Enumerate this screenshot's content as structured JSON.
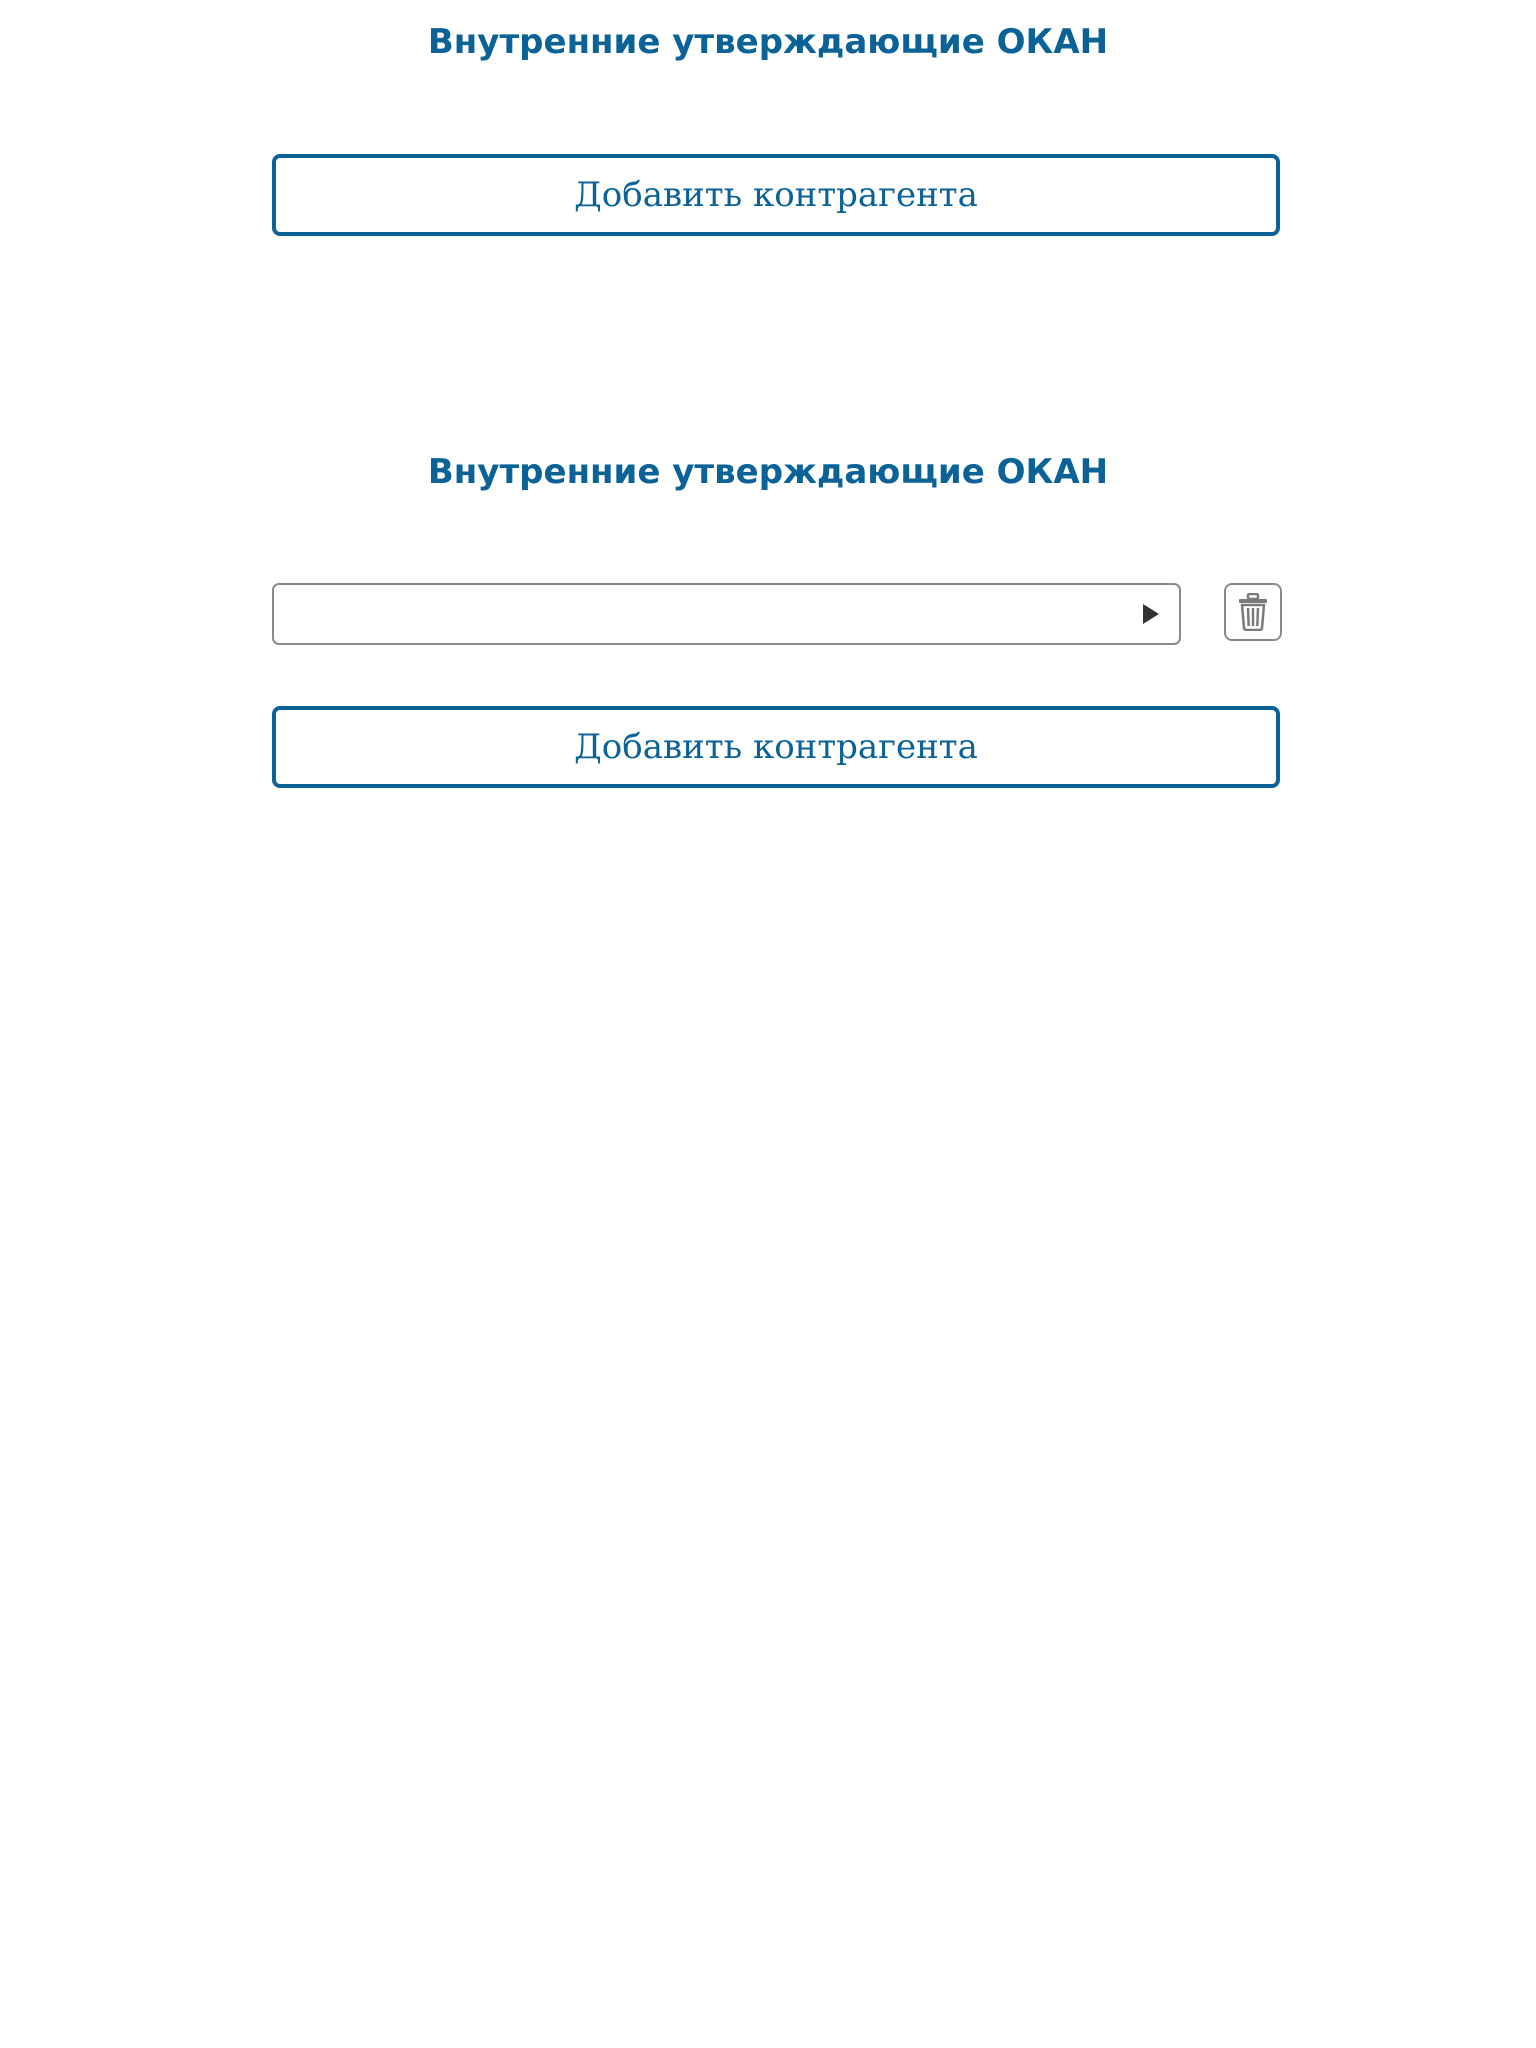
{
  "sections": [
    {
      "title": "Внутренние утверждающие ОКАН",
      "add_button_label": "Добавить контрагента"
    },
    {
      "title": "Внутренние утверждающие ОКАН",
      "rows": [
        {
          "value": "",
          "expand_icon": "play-triangle-icon",
          "delete_icon": "trash-icon"
        }
      ],
      "add_button_label": "Добавить контрагента"
    }
  ],
  "colors": {
    "accent": "#0a6296",
    "border_gray": "#8a8a8a",
    "icon_dark": "#333333"
  }
}
